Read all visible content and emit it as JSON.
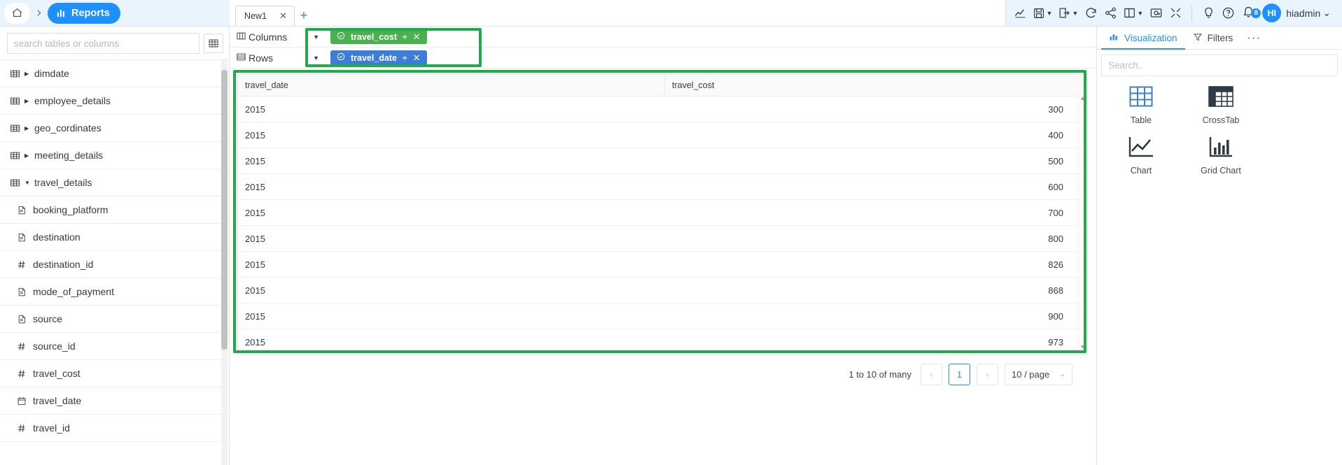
{
  "breadcrumb": {
    "home_icon": "home-icon",
    "separator": "›",
    "active_icon": "reports-chart-icon",
    "active_label": "Reports"
  },
  "tabs": {
    "items": [
      {
        "label": "New1",
        "close": "✕"
      }
    ],
    "add_label": "+"
  },
  "toolbar": {
    "icons": [
      {
        "name": "line-chart-icon",
        "caret": false
      },
      {
        "name": "save-icon",
        "caret": true
      },
      {
        "name": "export-icon",
        "caret": true
      },
      {
        "name": "refresh-icon",
        "caret": false
      },
      {
        "name": "share-icon",
        "caret": false
      },
      {
        "name": "layout-panel-icon",
        "caret": true
      },
      {
        "name": "embed-icon",
        "caret": false
      },
      {
        "name": "fullscreen-icon",
        "caret": false
      }
    ],
    "help_icons": [
      {
        "name": "lightbulb-icon"
      },
      {
        "name": "question-circle-icon"
      }
    ],
    "notifications": {
      "icon": "bell-icon",
      "count": "8"
    },
    "user": {
      "initials": "HI",
      "name": "hiadmin",
      "caret": "⌄"
    }
  },
  "sidebar": {
    "search": {
      "placeholder": "search tables or columns",
      "value": ""
    },
    "grid_button_icon": "table-grid-icon",
    "tables": [
      {
        "label": "dimdate",
        "icon": "table-icon",
        "arrow": "▶",
        "expanded": false
      },
      {
        "label": "employee_details",
        "icon": "table-icon",
        "arrow": "▶",
        "expanded": false
      },
      {
        "label": "geo_cordinates",
        "icon": "table-icon",
        "arrow": "▶",
        "expanded": false
      },
      {
        "label": "meeting_details",
        "icon": "table-icon",
        "arrow": "▶",
        "expanded": false
      },
      {
        "label": "travel_details",
        "icon": "table-icon",
        "arrow": "▼",
        "expanded": true
      }
    ],
    "columns": [
      {
        "label": "booking_platform",
        "type": "text"
      },
      {
        "label": "destination",
        "type": "text"
      },
      {
        "label": "destination_id",
        "type": "number"
      },
      {
        "label": "mode_of_payment",
        "type": "text"
      },
      {
        "label": "source",
        "type": "text"
      },
      {
        "label": "source_id",
        "type": "number"
      },
      {
        "label": "travel_cost",
        "type": "number"
      },
      {
        "label": "travel_date",
        "type": "date"
      },
      {
        "label": "travel_id",
        "type": "number"
      }
    ]
  },
  "shelves": [
    {
      "label": "Columns",
      "icon": "columns-icon",
      "caret": "▼",
      "pill": {
        "label": "travel_cost",
        "color": "#4caf50",
        "check": "check-circle-icon",
        "divider": "÷",
        "close": "✕"
      }
    },
    {
      "label": "Rows",
      "icon": "rows-icon",
      "caret": "▼",
      "pill": {
        "label": "travel_date",
        "color": "#3b7dd8",
        "check": "check-circle-icon",
        "divider": "÷",
        "close": "✕"
      }
    }
  ],
  "highlight_color": "#22a94b",
  "table": {
    "columns": [
      "travel_date",
      "travel_cost"
    ],
    "rows": [
      [
        "2015",
        "300"
      ],
      [
        "2015",
        "400"
      ],
      [
        "2015",
        "500"
      ],
      [
        "2015",
        "600"
      ],
      [
        "2015",
        "700"
      ],
      [
        "2015",
        "800"
      ],
      [
        "2015",
        "826"
      ],
      [
        "2015",
        "868"
      ],
      [
        "2015",
        "900"
      ],
      [
        "2015",
        "973"
      ]
    ]
  },
  "pagination": {
    "info": "1 to 10 of many",
    "prev": "‹",
    "current_page": "1",
    "next": "›",
    "page_size": "10 / page",
    "page_size_caret": "⌄"
  },
  "right_panel": {
    "tabs": [
      {
        "label": "Visualization",
        "icon": "bar-chart-icon",
        "active": true
      },
      {
        "label": "Filters",
        "icon": "filter-icon",
        "active": false
      }
    ],
    "more": "···",
    "search": {
      "placeholder": "Search..",
      "value": ""
    },
    "visualizations": [
      {
        "label": "Table",
        "icon": "table-viz-icon",
        "selected": true
      },
      {
        "label": "CrossTab",
        "icon": "crosstab-viz-icon",
        "selected": false
      },
      {
        "label": "Chart",
        "icon": "chart-viz-icon",
        "selected": false
      },
      {
        "label": "Grid Chart",
        "icon": "grid-chart-viz-icon",
        "selected": false
      }
    ]
  }
}
